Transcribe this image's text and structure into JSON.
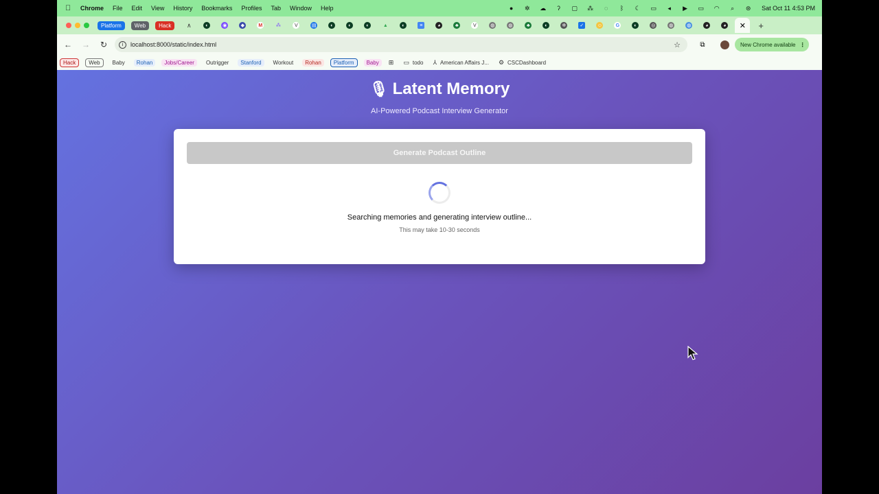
{
  "menubar": {
    "app": "Chrome",
    "items": [
      "File",
      "Edit",
      "View",
      "History",
      "Bookmarks",
      "Profiles",
      "Tab",
      "Window",
      "Help"
    ],
    "datetime": "Sat Oct 11  4:53 PM"
  },
  "tabs": {
    "groups": [
      {
        "label": "Platform",
        "color": "#1a73e8"
      },
      {
        "label": "Web",
        "color": "#5f6368"
      },
      {
        "label": "Hack",
        "color": "#d93025"
      }
    ],
    "active_close": "✕",
    "new_tab": "+"
  },
  "toolbar": {
    "url": "localhost:8000/static/index.html",
    "update_label": "New Chrome available"
  },
  "bookmarks": {
    "items": [
      {
        "label": "Hack",
        "style": "outline-red"
      },
      {
        "label": "Web",
        "style": "outline-gray"
      },
      {
        "label": "Baby",
        "style": "plain"
      },
      {
        "label": "Rohan",
        "style": "blue"
      },
      {
        "label": "Jobs/Career",
        "style": "pink"
      },
      {
        "label": "Outrigger",
        "style": "plain"
      },
      {
        "label": "Stanford",
        "style": "blue"
      },
      {
        "label": "Workout",
        "style": "plain"
      },
      {
        "label": "Rohan",
        "style": "red"
      },
      {
        "label": "Platform",
        "style": "outline-blue"
      },
      {
        "label": "Baby",
        "style": "pink"
      }
    ],
    "folder": "todo",
    "link1": "American Affairs J...",
    "link2": "CSCDashboard"
  },
  "app": {
    "title": "Latent Memory",
    "subtitle": "AI-Powered Podcast Interview Generator",
    "generate_label": "Generate Podcast Outline",
    "loading_text": "Searching memories and generating interview outline...",
    "loading_sub": "This may take 10-30 seconds"
  }
}
